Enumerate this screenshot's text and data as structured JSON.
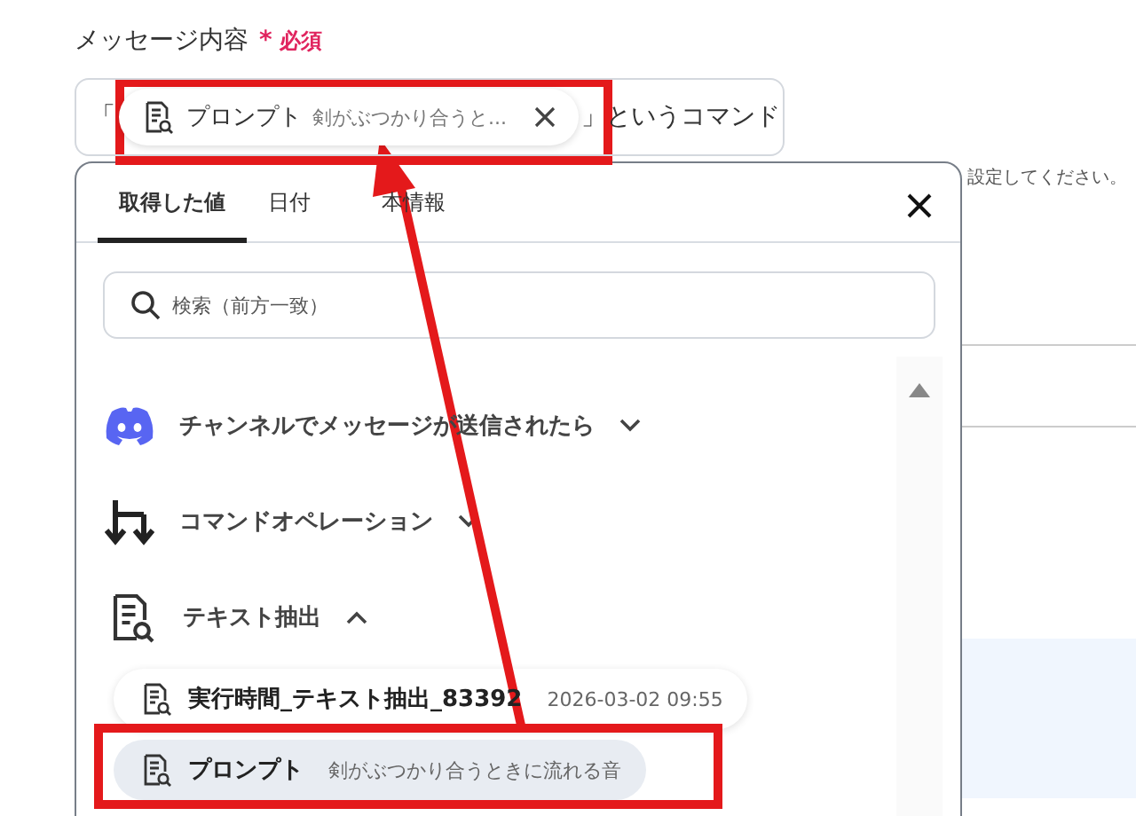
{
  "field": {
    "label": "メッセージ内容",
    "required_mark": "*",
    "required_text": "必須",
    "prefix": "「",
    "chip": {
      "name": "プロンプト",
      "value": "剣がぶつかり合うと..."
    },
    "suffix": "」というコマンド"
  },
  "hint": "設定してください。",
  "panel": {
    "tabs": [
      {
        "label": "取得した値",
        "selected": true
      },
      {
        "label": "日付",
        "selected": false
      },
      {
        "label": "本情報",
        "selected": false
      }
    ],
    "search": {
      "placeholder": "検索（前方一致）"
    },
    "groups": [
      {
        "kind": "discord",
        "name": "チャンネルでメッセージが送信されたら",
        "expanded": false
      },
      {
        "kind": "command",
        "name": "コマンドオペレーション",
        "expanded": false
      },
      {
        "kind": "text",
        "name": "テキスト抽出",
        "expanded": true,
        "children": [
          {
            "name": "実行時間_テキスト抽出_83392",
            "value": "2026-03-02 09:55",
            "selected": false
          },
          {
            "name": "プロンプト",
            "value": "剣がぶつかり合うときに流れる音",
            "selected": true
          }
        ]
      }
    ]
  }
}
